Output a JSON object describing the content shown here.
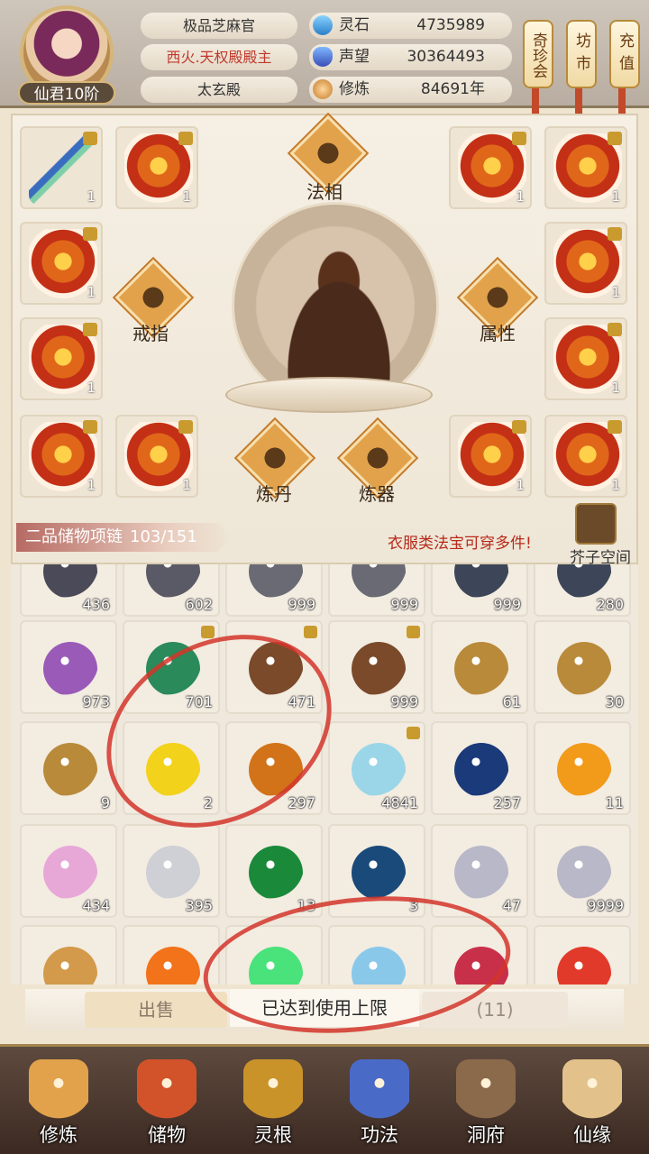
{
  "header": {
    "avatar_level": "仙君10阶",
    "titles": [
      "极品芝麻官",
      "西火.天权殿殿主",
      "太玄殿"
    ],
    "resources": [
      {
        "label": "灵石",
        "value": "4735989",
        "icon": "spirit-stone-icon"
      },
      {
        "label": "声望",
        "value": "30364493",
        "icon": "crystal-icon"
      },
      {
        "label": "修炼",
        "value": "84691年",
        "icon": "meditation-icon"
      }
    ],
    "buttons": [
      "奇珍会",
      "坊市",
      "充值"
    ]
  },
  "equipment": {
    "slot_count": "1",
    "functions": [
      "法相",
      "戒指",
      "属性",
      "炼丹",
      "炼器"
    ]
  },
  "ring_bar": {
    "label": "二品储物项链",
    "capacity": "103/151"
  },
  "notice": "衣服类法宝可穿多件!",
  "jiezi_label": "芥子空间",
  "inventory": {
    "rows": [
      [
        {
          "count": "436",
          "color": "#4a4a58",
          "locked": false
        },
        {
          "count": "602",
          "color": "#5a5a66",
          "locked": false
        },
        {
          "count": "999",
          "color": "#6a6a74",
          "locked": false
        },
        {
          "count": "999",
          "color": "#6a6a74",
          "locked": false
        },
        {
          "count": "999",
          "color": "#3d4658",
          "locked": false
        },
        {
          "count": "280",
          "color": "#3d4658",
          "locked": false
        }
      ],
      [
        {
          "count": "973",
          "color": "#9a5ab8",
          "locked": false
        },
        {
          "count": "701",
          "color": "#2a8a5a",
          "locked": true
        },
        {
          "count": "471",
          "color": "#7a4a2a",
          "locked": true
        },
        {
          "count": "999",
          "color": "#7a4a2a",
          "locked": true
        },
        {
          "count": "61",
          "color": "#b88a3a",
          "locked": false
        },
        {
          "count": "30",
          "color": "#b88a3a",
          "locked": false
        }
      ],
      [
        {
          "count": "9",
          "color": "#b88a3a",
          "locked": false
        },
        {
          "count": "2",
          "color": "#f2d21a",
          "locked": false
        },
        {
          "count": "297",
          "color": "#d2731a",
          "locked": false
        },
        {
          "count": "4841",
          "color": "#9ad6e8",
          "locked": true
        },
        {
          "count": "257",
          "color": "#1a3a7a",
          "locked": false
        },
        {
          "count": "11",
          "color": "#f29a1a",
          "locked": false
        }
      ],
      [
        {
          "count": "434",
          "color": "#e7a8d8",
          "locked": false
        },
        {
          "count": "395",
          "color": "#cfcfd6",
          "locked": false
        },
        {
          "count": "13",
          "color": "#1a8a3a",
          "locked": false
        },
        {
          "count": "3",
          "color": "#1a4a7a",
          "locked": false
        },
        {
          "count": "47",
          "color": "#b8b8c8",
          "locked": false
        },
        {
          "count": "9999",
          "color": "#b8b8c8",
          "locked": false
        }
      ],
      [
        {
          "count": "",
          "color": "#d29a4a",
          "locked": false
        },
        {
          "count": "",
          "color": "#f2731a",
          "locked": false
        },
        {
          "count": "",
          "color": "#4ae27a",
          "locked": false
        },
        {
          "count": "",
          "color": "#8ac8ea",
          "locked": false
        },
        {
          "count": "",
          "color": "#c8304a",
          "locked": false
        },
        {
          "count": "",
          "color": "#e23a2a",
          "locked": false
        }
      ]
    ]
  },
  "actions": {
    "sell": "出售",
    "toast": "已达到使用上限",
    "count": "(11)"
  },
  "nav": [
    {
      "label": "修炼",
      "color": "#e2a24b"
    },
    {
      "label": "储物",
      "color": "#d2532a"
    },
    {
      "label": "灵根",
      "color": "#c9932a"
    },
    {
      "label": "功法",
      "color": "#4a6ac8"
    },
    {
      "label": "洞府",
      "color": "#8a6a4a"
    },
    {
      "label": "仙缘",
      "color": "#e2c28a"
    }
  ],
  "colors": {
    "accent": "#d2352a",
    "notice": "#b72a1a",
    "gold": "#d6b676"
  }
}
